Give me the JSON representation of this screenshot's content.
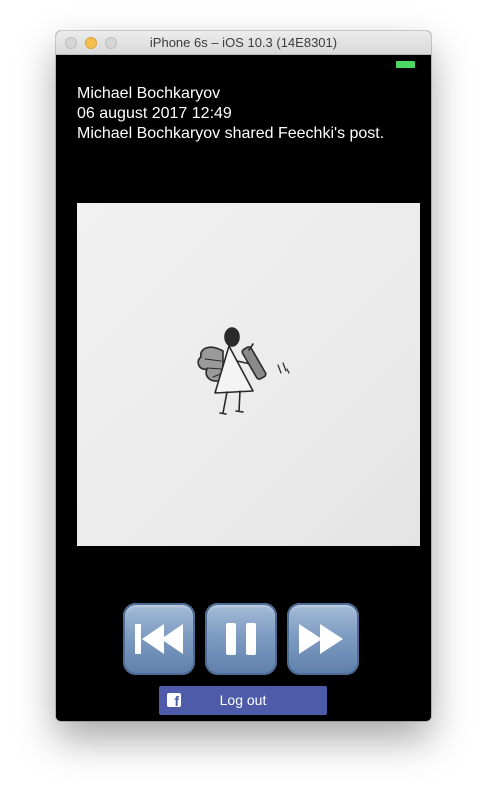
{
  "window": {
    "title": "iPhone 6s – iOS 10.3 (14E8301)"
  },
  "status_bar": {
    "battery_color": "#4cd964"
  },
  "post": {
    "author": "Michael Bochkaryov",
    "date": "06 august 2017 12:49",
    "message": "Michael Bochkaryov shared Feechki's post."
  },
  "player": {
    "buttons": [
      {
        "name": "rewind-button",
        "icon": "rewind-icon"
      },
      {
        "name": "pause-button",
        "icon": "pause-icon"
      },
      {
        "name": "fast-forward-button",
        "icon": "fast-forward-icon"
      }
    ],
    "button_color": "#7f9cc2"
  },
  "auth": {
    "logout_label": "Log out",
    "icon": "facebook-icon",
    "button_color": "#4d5ba9"
  }
}
